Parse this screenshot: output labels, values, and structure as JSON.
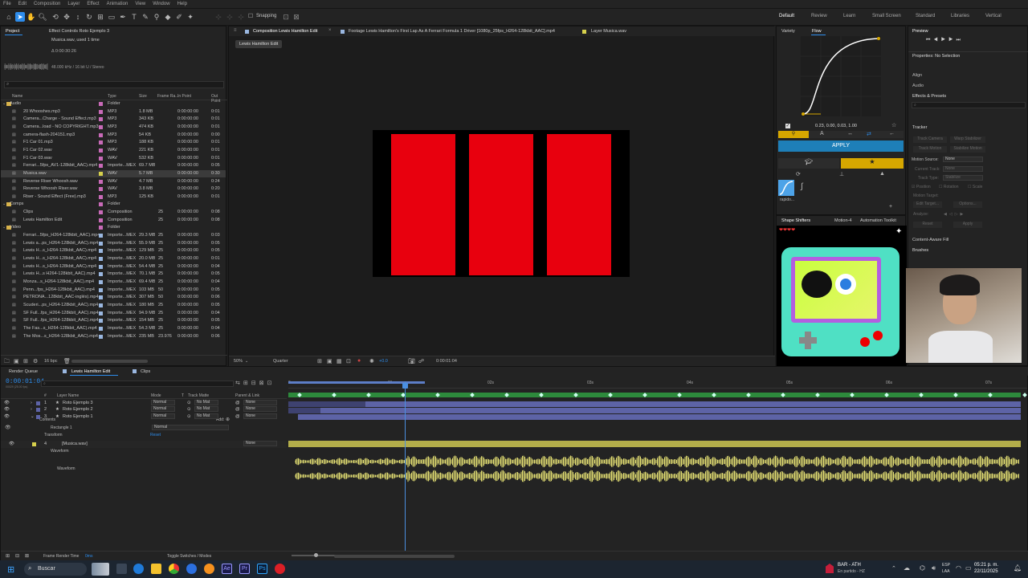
{
  "menu": [
    "File",
    "Edit",
    "Composition",
    "Layer",
    "Effect",
    "Animation",
    "View",
    "Window",
    "Help"
  ],
  "toolbar": {
    "snapping": "Snapping",
    "workspaces": [
      "Default",
      "Review",
      "Learn",
      "Small Screen",
      "Standard",
      "Libraries",
      "Vertical"
    ]
  },
  "project": {
    "tab": "Project",
    "effect_tab": "Effect Controls Roto Ejemplo 3",
    "file_name": "Musica.wav",
    "used": ", used 1 time",
    "duration": "Δ 0:00:30:26",
    "audio_info": "48.000 kHz / 16 bit U / Stereo",
    "headers": [
      "Name",
      "Type",
      "Size",
      "Frame Ra...",
      "In Point",
      "Out Point"
    ],
    "rows": [
      {
        "name": "Audio",
        "type": "Folder",
        "size": "",
        "fr": "",
        "in": "",
        "out": "",
        "folder": true,
        "color": "#c96ab8"
      },
      {
        "name": "20 Whooshes.mp3",
        "type": "MP3",
        "size": "1.8 MB",
        "fr": "",
        "in": "0:00:00:00",
        "out": "0:01",
        "color": "#c96ab8"
      },
      {
        "name": "Camera...Charge - Sound Effect.mp3",
        "type": "MP3",
        "size": "343 KB",
        "fr": "",
        "in": "0:00:00:00",
        "out": "0:01",
        "color": "#c96ab8"
      },
      {
        "name": "Camera...load - NO COPYRIGHT.mp3",
        "type": "MP3",
        "size": "474 KB",
        "fr": "",
        "in": "0:00:00:00",
        "out": "0:01",
        "color": "#c96ab8"
      },
      {
        "name": "camera-flash-204151.mp3",
        "type": "MP3",
        "size": "54 KB",
        "fr": "",
        "in": "0:00:00:00",
        "out": "0:00",
        "color": "#c96ab8"
      },
      {
        "name": "F1 Car 01.mp3",
        "type": "MP3",
        "size": "188 KB",
        "fr": "",
        "in": "0:00:00:00",
        "out": "0:01",
        "color": "#c96ab8"
      },
      {
        "name": "F1 Car 02.wav",
        "type": "WAV",
        "size": "221 KB",
        "fr": "",
        "in": "0:00:00:00",
        "out": "0:01",
        "color": "#c96ab8"
      },
      {
        "name": "F1 Car 03.wav",
        "type": "WAV",
        "size": "532 KB",
        "fr": "",
        "in": "0:00:00:00",
        "out": "0:01",
        "color": "#c96ab8"
      },
      {
        "name": "Ferrari...5fps_AV1-128kbit_AAC).mp4",
        "type": "Importe...MEX",
        "size": "69.7 MB",
        "fr": "",
        "in": "0:00:00:00",
        "out": "0:05",
        "color": "#c96ab8"
      },
      {
        "name": "Musica.wav",
        "type": "WAV",
        "size": "5.7 MB",
        "fr": "",
        "in": "0:00:00:00",
        "out": "0:30",
        "color": "#d6d04c",
        "selected": true
      },
      {
        "name": "Reverse Riser Whoosh.wav",
        "type": "WAV",
        "size": "4.7 MB",
        "fr": "",
        "in": "0:00:00:00",
        "out": "0:24",
        "color": "#c96ab8"
      },
      {
        "name": "Reverse Whoosh Riser.wav",
        "type": "WAV",
        "size": "3.8 MB",
        "fr": "",
        "in": "0:00:00:00",
        "out": "0:20",
        "color": "#c96ab8"
      },
      {
        "name": "Riser - Sound Effect (Free).mp3",
        "type": "MP3",
        "size": "125 KB",
        "fr": "",
        "in": "0:00:00:00",
        "out": "0:01",
        "color": "#c96ab8"
      },
      {
        "name": "Comps",
        "type": "Folder",
        "size": "",
        "fr": "",
        "in": "",
        "out": "",
        "folder": true,
        "color": "#c96ab8"
      },
      {
        "name": "Clips",
        "type": "Composition",
        "size": "",
        "fr": "25",
        "in": "0:00:00:00",
        "out": "0:08",
        "color": "#c96ab8"
      },
      {
        "name": "Lewis Hamilton Edit",
        "type": "Composition",
        "size": "",
        "fr": "25",
        "in": "0:00:00:00",
        "out": "0:08",
        "color": "#c96ab8"
      },
      {
        "name": "Video",
        "type": "Folder",
        "size": "",
        "fr": "",
        "in": "",
        "out": "",
        "folder": true,
        "color": "#c96ab8"
      },
      {
        "name": "Ferrari...5fps_H264-128kbit_AAC).mp4",
        "type": "Importe...MEX",
        "size": "29.3 MB",
        "fr": "25",
        "in": "0:00:00:00",
        "out": "0:03",
        "color": "#9ab7e0"
      },
      {
        "name": "Lewis a...ps_H264-128kbit_AAC).mp4",
        "type": "Importe...MEX",
        "size": "55.9 MB",
        "fr": "25",
        "in": "0:00:00:00",
        "out": "0:05",
        "color": "#9ab7e0"
      },
      {
        "name": "Lewis H...s_H264-128kbit_AAC).mp4",
        "type": "Importe...MEX",
        "size": "129 MB",
        "fr": "25",
        "in": "0:00:00:00",
        "out": "0:05",
        "color": "#9ab7e0"
      },
      {
        "name": "Lewis H...s_H264-128kbit_AAC).mp4",
        "type": "Importe...MEX",
        "size": "20.0 MB",
        "fr": "25",
        "in": "0:00:00:00",
        "out": "0:01",
        "color": "#9ab7e0"
      },
      {
        "name": "Lewis H...s_H264-128kbit_AAC).mp4",
        "type": "Importe...MEX",
        "size": "54.4 MB",
        "fr": "25",
        "in": "0:00:00:00",
        "out": "0:04",
        "color": "#9ab7e0"
      },
      {
        "name": "Lewis H...s H264-128kbit_AAC).mp4",
        "type": "Importe...MEX",
        "size": "70.1 MB",
        "fr": "25",
        "in": "0:00:00:00",
        "out": "0:05",
        "color": "#9ab7e0"
      },
      {
        "name": "Monza...s_H264-128kbit_AAC).mp4",
        "type": "Importe...MEX",
        "size": "69.4 MB",
        "fr": "25",
        "in": "0:00:00:00",
        "out": "0:04",
        "color": "#9ab7e0"
      },
      {
        "name": "Penn...fps_H264-128kbit_AAC).mp4",
        "type": "Importe...MEX",
        "size": "103 MB",
        "fr": "50",
        "in": "0:00:00:00",
        "out": "0:05",
        "color": "#9ab7e0"
      },
      {
        "name": "PETRONA...128kbit_AAC-inglés).mp4",
        "type": "Importe...MEX",
        "size": "307 MB",
        "fr": "50",
        "in": "0:00:00:00",
        "out": "0:06",
        "color": "#9ab7e0"
      },
      {
        "name": "Scuderi...ps_H264-128kbit_AAC).mp4",
        "type": "Importe...MEX",
        "size": "180 MB",
        "fr": "25",
        "in": "0:00:00:00",
        "out": "0:05",
        "color": "#9ab7e0"
      },
      {
        "name": "SF Full...fps_H264-128kbit_AAC).mp4",
        "type": "Importe...MEX",
        "size": "94.9 MB",
        "fr": "25",
        "in": "0:00:00:00",
        "out": "0:04",
        "color": "#9ab7e0"
      },
      {
        "name": "SF Full...fps_H264-128kbit_AAC).mp4",
        "type": "Importe...MEX",
        "size": "154 MB",
        "fr": "25",
        "in": "0:00:00:00",
        "out": "0:05",
        "color": "#9ab7e0"
      },
      {
        "name": "The Fas...s_H264-128kbit_AAC).mp4",
        "type": "Importe...MEX",
        "size": "54.3 MB",
        "fr": "25",
        "in": "0:00:00:00",
        "out": "0:04",
        "color": "#9ab7e0"
      },
      {
        "name": "The Mos...s_H264-128kbit_AAC).mp4",
        "type": "Importe...MEX",
        "size": "235 MB",
        "fr": "23.976",
        "in": "0:00:00:00",
        "out": "0:06",
        "color": "#9ab7e0"
      }
    ],
    "bpc": "16 bpc"
  },
  "viewer": {
    "tabs": [
      "Composition Lewis Hamilton Edit",
      "Footage Lewis Hamilton's First Lap As A Ferrari Formula 1 Driver [1080p_25fps_H264-128kbit_AAC].mp4",
      "Layer Musica.wav"
    ],
    "subtab": "Lewis Hamilton Edit",
    "zoom": "50%",
    "quality": "Quarter",
    "timecode": "0:00:01:04",
    "exposure": "+0.0"
  },
  "flow": {
    "tab_variety": "Variety",
    "tab_flow": "Flow",
    "values": "0.23, 0.00, 0.03, 1.00",
    "apply": "APPLY",
    "preset_label": "rapido..."
  },
  "shape": {
    "tabs": [
      "Shape Shifters",
      "Motion-4",
      "Automation Toolkit"
    ]
  },
  "right": {
    "preview": "Preview",
    "props": "Properties: No Selection",
    "align": "Align",
    "audio": "Audio",
    "effects": "Effects & Presets",
    "tracker": "Tracker",
    "track_camera": "Track Camera",
    "warp": "Warp Stabilizer",
    "track_motion": "Track Motion",
    "stabilize": "Stabilize Motion",
    "motion_source": "Motion Source:",
    "motion_source_val": "None",
    "current_track": "Current Track:",
    "current_track_val": "None",
    "track_type": "Track Type:",
    "track_type_val": "Stabilize",
    "position": "Position",
    "rotation": "Rotation",
    "scale": "Scale",
    "motion_target": "Motion Target:",
    "edit_target": "Edit Target...",
    "options": "Options...",
    "analyze": "Analyze:",
    "reset": "Reset",
    "apply": "Apply",
    "caf": "Content-Aware Fill",
    "brushes": "Brushes"
  },
  "timeline": {
    "tabs": [
      "Render Queue",
      "Lewis Hamilton Edit",
      "Clips"
    ],
    "timecode": "0:00:01:04",
    "fps_info": "00029 (25.00 fps)",
    "headers": [
      "#",
      "Layer Name",
      "Mode",
      "T",
      "Track Matte",
      "Parent & Link"
    ],
    "layers": [
      {
        "num": "1",
        "name": "Roto Ejemplo 3",
        "mode": "Normal",
        "matte": "No Mat",
        "parent": "None"
      },
      {
        "num": "2",
        "name": "Roto Ejemplo 2",
        "mode": "Normal",
        "matte": "No Mat",
        "parent": "None"
      },
      {
        "num": "3",
        "name": "Roto Ejemplo 1",
        "mode": "Normal",
        "matte": "No Mat",
        "parent": "None"
      }
    ],
    "contents": "Contents",
    "add": "Add:",
    "rect": "Rectangle 1",
    "rect_mode": "Normal",
    "transform": "Transform",
    "reset": "Reset",
    "audio_layer_num": "4",
    "audio_layer": "[Musica.wav]",
    "audio_parent": "None",
    "waveform": "Waveform",
    "waveform2": "Waveform",
    "ruler": [
      "0s",
      "01s",
      "02s",
      "03s",
      "04s",
      "05s",
      "06s",
      "07s"
    ],
    "render_time": "Frame Render Time",
    "render_val": "0ms",
    "toggle": "Toggle Switches / Modes"
  },
  "taskbar": {
    "search": "Buscar",
    "sports": "BAR - ATH",
    "sports_sub": "En partido - HZ",
    "lang": "ESP",
    "lang2": "LAA",
    "time": "05:21 p. m.",
    "date": "22/11/2025"
  },
  "colors": {
    "accent": "#2d8ceb",
    "red": "#e8000e",
    "audio": "#d6d04c",
    "layer": "#5d63a6"
  }
}
